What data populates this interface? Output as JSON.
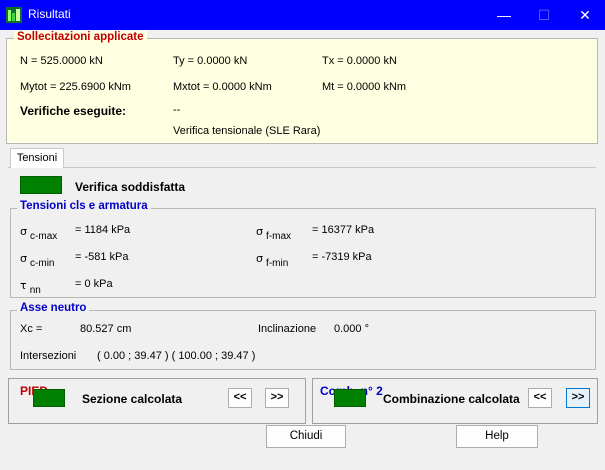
{
  "window": {
    "title": "Risultati",
    "minimize": "—",
    "maximize": "☐",
    "close": "✕"
  },
  "sollecitazioni": {
    "legend": "Sollecitazioni applicate",
    "n": "N = 525.0000 kN",
    "ty": "Ty = 0.0000 kN",
    "tx": "Tx = 0.0000 kN",
    "mytot": "Mytot = 225.6900 kNm",
    "mxtot": "Mxtot = 0.0000 kNm",
    "mt": "Mt = 0.0000 kNm",
    "verifiche_label": "Verifiche eseguite:",
    "verifiche_value": "--",
    "verifica_tipo": "Verifica tensionale (SLE Rara)"
  },
  "tabs": [
    {
      "label": "Tensioni"
    }
  ],
  "status": {
    "label": "Verifica soddisfatta",
    "color": "#008000"
  },
  "tensioni": {
    "legend": "Tensioni cls e armatura",
    "sigma": "σ",
    "tau": "τ",
    "c_max_sub": "c-max",
    "c_max_val": "= 1184 kPa",
    "c_min_sub": "c-min",
    "c_min_val": "= -581 kPa",
    "nn_sub": "nn",
    "nn_val": "= 0 kPa",
    "f_max_sub": "f-max",
    "f_max_val": "= 16377 kPa",
    "f_min_sub": "f-min",
    "f_min_val": "= -7319 kPa"
  },
  "asse_neutro": {
    "legend": "Asse neutro",
    "xc_label": "Xc =",
    "xc_value": "80.527 cm",
    "incl_label": "Inclinazione",
    "incl_value": "0.000 °",
    "intersezioni_label": "Intersezioni",
    "intersezioni_value": "( 0.00 ; 39.47 ) ( 100.00 ; 39.47 )"
  },
  "sezione": {
    "title": "PIED",
    "prev": "<<",
    "next": ">>",
    "status": "Sezione calcolata"
  },
  "combinazione": {
    "title": "Comb. n° 2",
    "prev": "<<",
    "next": ">>",
    "status": "Combinazione calcolata"
  },
  "buttons": {
    "close": "Chiudi",
    "help": "Help"
  },
  "colors": {
    "titlebar": "#0000ff",
    "panel_yellow": "#ffffe1",
    "legend_red": "#c00000",
    "legend_blue": "#0000c8",
    "ok_green": "#008000"
  }
}
